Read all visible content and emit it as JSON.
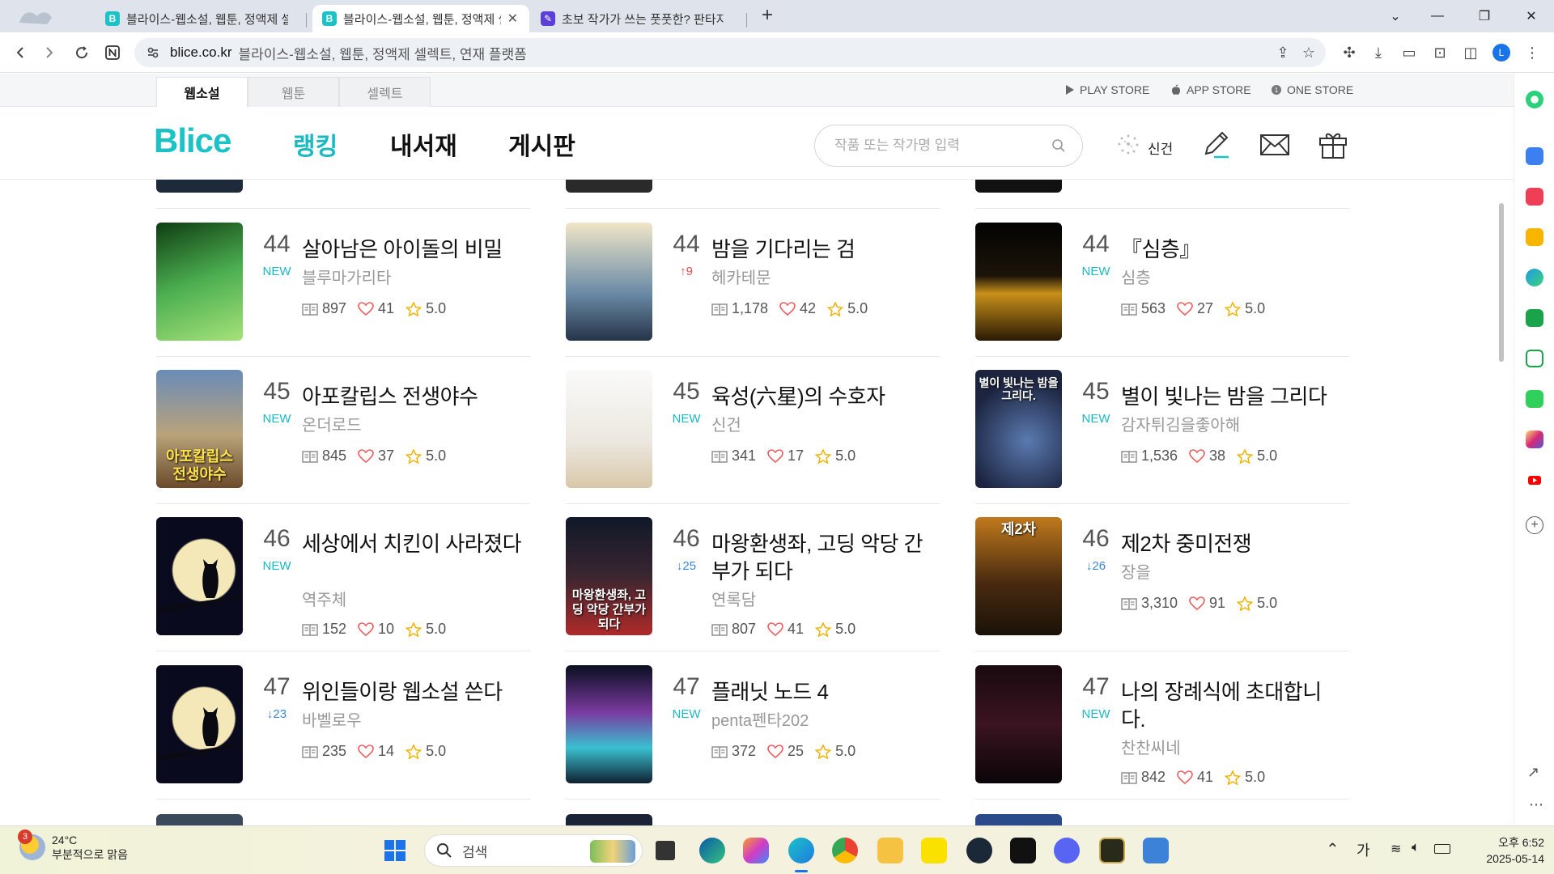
{
  "browser": {
    "tabs": [
      {
        "title": "블라이스-웹소설, 웹툰, 정액제 셀렉트, 연재 플랫폼",
        "active": false,
        "favicon": "B"
      },
      {
        "title": "블라이스-웹소설, 웹툰, 정액제 셀렉트, 연재 플랫폼",
        "active": true,
        "favicon": "B"
      },
      {
        "title": "초보 작가가 쓰는 풋풋한? 판타지",
        "active": false,
        "favicon": ""
      }
    ],
    "address_domain": "blice.co.kr",
    "address_title": "블라이스-웹소설, 웹툰, 정액제 셀렉트, 연재 플랫폼",
    "profile_initial": "L"
  },
  "site": {
    "subtabs": [
      "웹소설",
      "웹툰",
      "셀렉트"
    ],
    "stores": [
      "PLAY STORE",
      "APP STORE",
      "ONE STORE"
    ],
    "logo": "Blice",
    "nav": [
      "랭킹",
      "내서재",
      "게시판"
    ],
    "search_placeholder": "작품 또는 작가명 입력",
    "user_name": "신건"
  },
  "ranking": {
    "columns": [
      [
        {
          "rank": "44",
          "badge": "NEW",
          "badge_type": "new",
          "title": "살아남은 아이돌의 비밀",
          "author": "블루마가리타",
          "episodes": "897",
          "likes": "41",
          "rating": "5.0"
        },
        {
          "rank": "45",
          "badge": "NEW",
          "badge_type": "new",
          "title": "아포칼립스 전생야수",
          "author": "온더로드",
          "episodes": "845",
          "likes": "37",
          "rating": "5.0",
          "cover_text": "아포칼립스 전생야수"
        },
        {
          "rank": "46",
          "badge": "NEW",
          "badge_type": "new",
          "title": "세상에서 치킨이 사라졌다",
          "author": "역주체",
          "episodes": "152",
          "likes": "10",
          "rating": "5.0"
        },
        {
          "rank": "47",
          "badge": "↓23",
          "badge_type": "down",
          "title": "위인들이랑 웹소설 쓴다",
          "author": "바벨로우",
          "episodes": "235",
          "likes": "14",
          "rating": "5.0"
        }
      ],
      [
        {
          "rank": "44",
          "badge": "↑9",
          "badge_type": "up",
          "title": "밤을 기다리는 검",
          "author": "헤카테문",
          "episodes": "1,178",
          "likes": "42",
          "rating": "5.0"
        },
        {
          "rank": "45",
          "badge": "NEW",
          "badge_type": "new",
          "title": "육성(六星)의 수호자",
          "author": "신건",
          "episodes": "341",
          "likes": "17",
          "rating": "5.0"
        },
        {
          "rank": "46",
          "badge": "↓25",
          "badge_type": "down",
          "title": "마왕환생좌, 고딩 악당 간부가 되다",
          "author": "연록담",
          "episodes": "807",
          "likes": "41",
          "rating": "5.0",
          "cover_text": "마왕환생좌, 고딩 악당 간부가 되다"
        },
        {
          "rank": "47",
          "badge": "NEW",
          "badge_type": "new",
          "title": "플래닛 노드 4",
          "author": "penta펜타202",
          "episodes": "372",
          "likes": "25",
          "rating": "5.0"
        }
      ],
      [
        {
          "rank": "44",
          "badge": "NEW",
          "badge_type": "new",
          "title": "『심층』",
          "author": "심층",
          "episodes": "563",
          "likes": "27",
          "rating": "5.0"
        },
        {
          "rank": "45",
          "badge": "NEW",
          "badge_type": "new",
          "title": "별이 빛나는 밤을 그리다",
          "author": "감자튀김을좋아해",
          "episodes": "1,536",
          "likes": "38",
          "rating": "5.0",
          "cover_text": "별이 빛나는 밤을 그리다."
        },
        {
          "rank": "46",
          "badge": "↓26",
          "badge_type": "down",
          "title": "제2차 중미전쟁",
          "author": "장을",
          "episodes": "3,310",
          "likes": "91",
          "rating": "5.0",
          "cover_text": "제2차"
        },
        {
          "rank": "47",
          "badge": "NEW",
          "badge_type": "new",
          "title": "나의 장례식에 초대합니다.",
          "author": "찬찬씨네",
          "episodes": "842",
          "likes": "41",
          "rating": "5.0"
        }
      ]
    ]
  },
  "taskbar": {
    "weather_temp": "24°C",
    "weather_desc": "부분적으로 맑음",
    "weather_badge": "3",
    "search_label": "검색",
    "ime": "가",
    "time": "오후 6:52",
    "date": "2025-05-14"
  }
}
